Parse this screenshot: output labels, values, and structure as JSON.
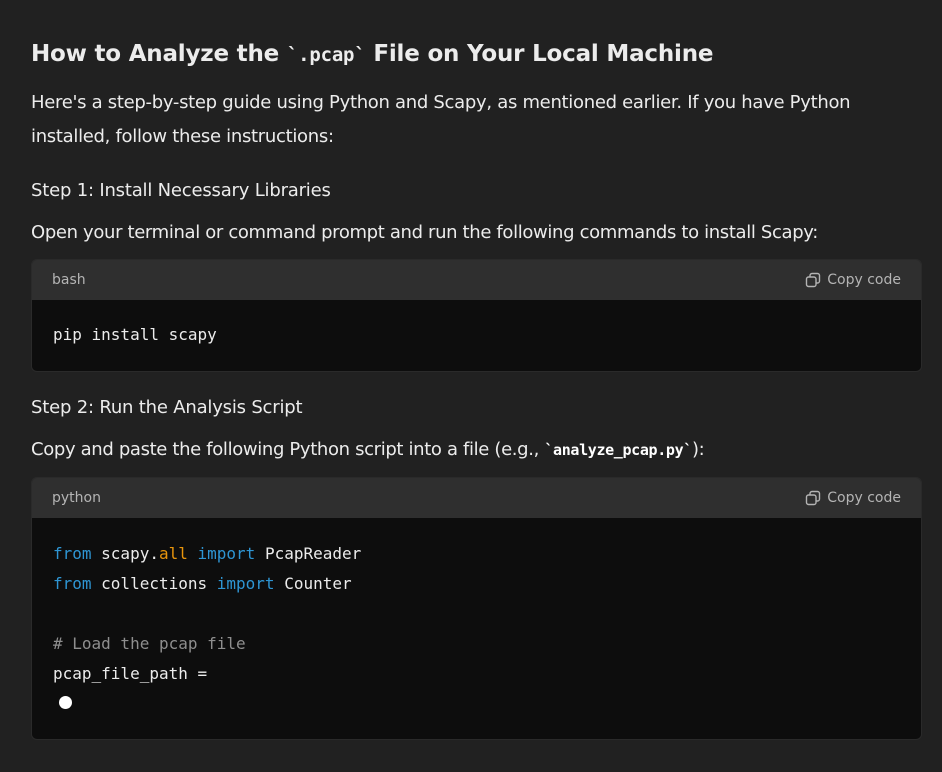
{
  "heading": {
    "prefix": "How to Analyze the ",
    "code": "`.pcap`",
    "suffix": " File on Your Local Machine"
  },
  "intro": "Here's a step-by-step guide using Python and Scapy, as mentioned earlier. If you have Python installed, follow these instructions:",
  "step1": {
    "title": "Step 1: Install Necessary Libraries",
    "text": "Open your terminal or command prompt and run the following commands to install Scapy:",
    "code_lang": "bash",
    "copy_label": "Copy code",
    "code": "pip install scapy"
  },
  "step2": {
    "title": "Step 2: Run the Analysis Script",
    "text_prefix": "Copy and paste the following Python script into a file (e.g., ",
    "text_code": "`analyze_pcap.py`",
    "text_suffix": "):",
    "code_lang": "python",
    "copy_label": "Copy code",
    "code": {
      "l1_from": "from",
      "l1_mod": " scapy.",
      "l1_attr": "all",
      "l1_import": "import",
      "l1_name": " PcapReader",
      "l2_from": "from",
      "l2_mod": " collections ",
      "l2_import": "import",
      "l2_name": " Counter",
      "l4_comment": "# Load the pcap file",
      "l5": "pcap_file_path ="
    }
  }
}
